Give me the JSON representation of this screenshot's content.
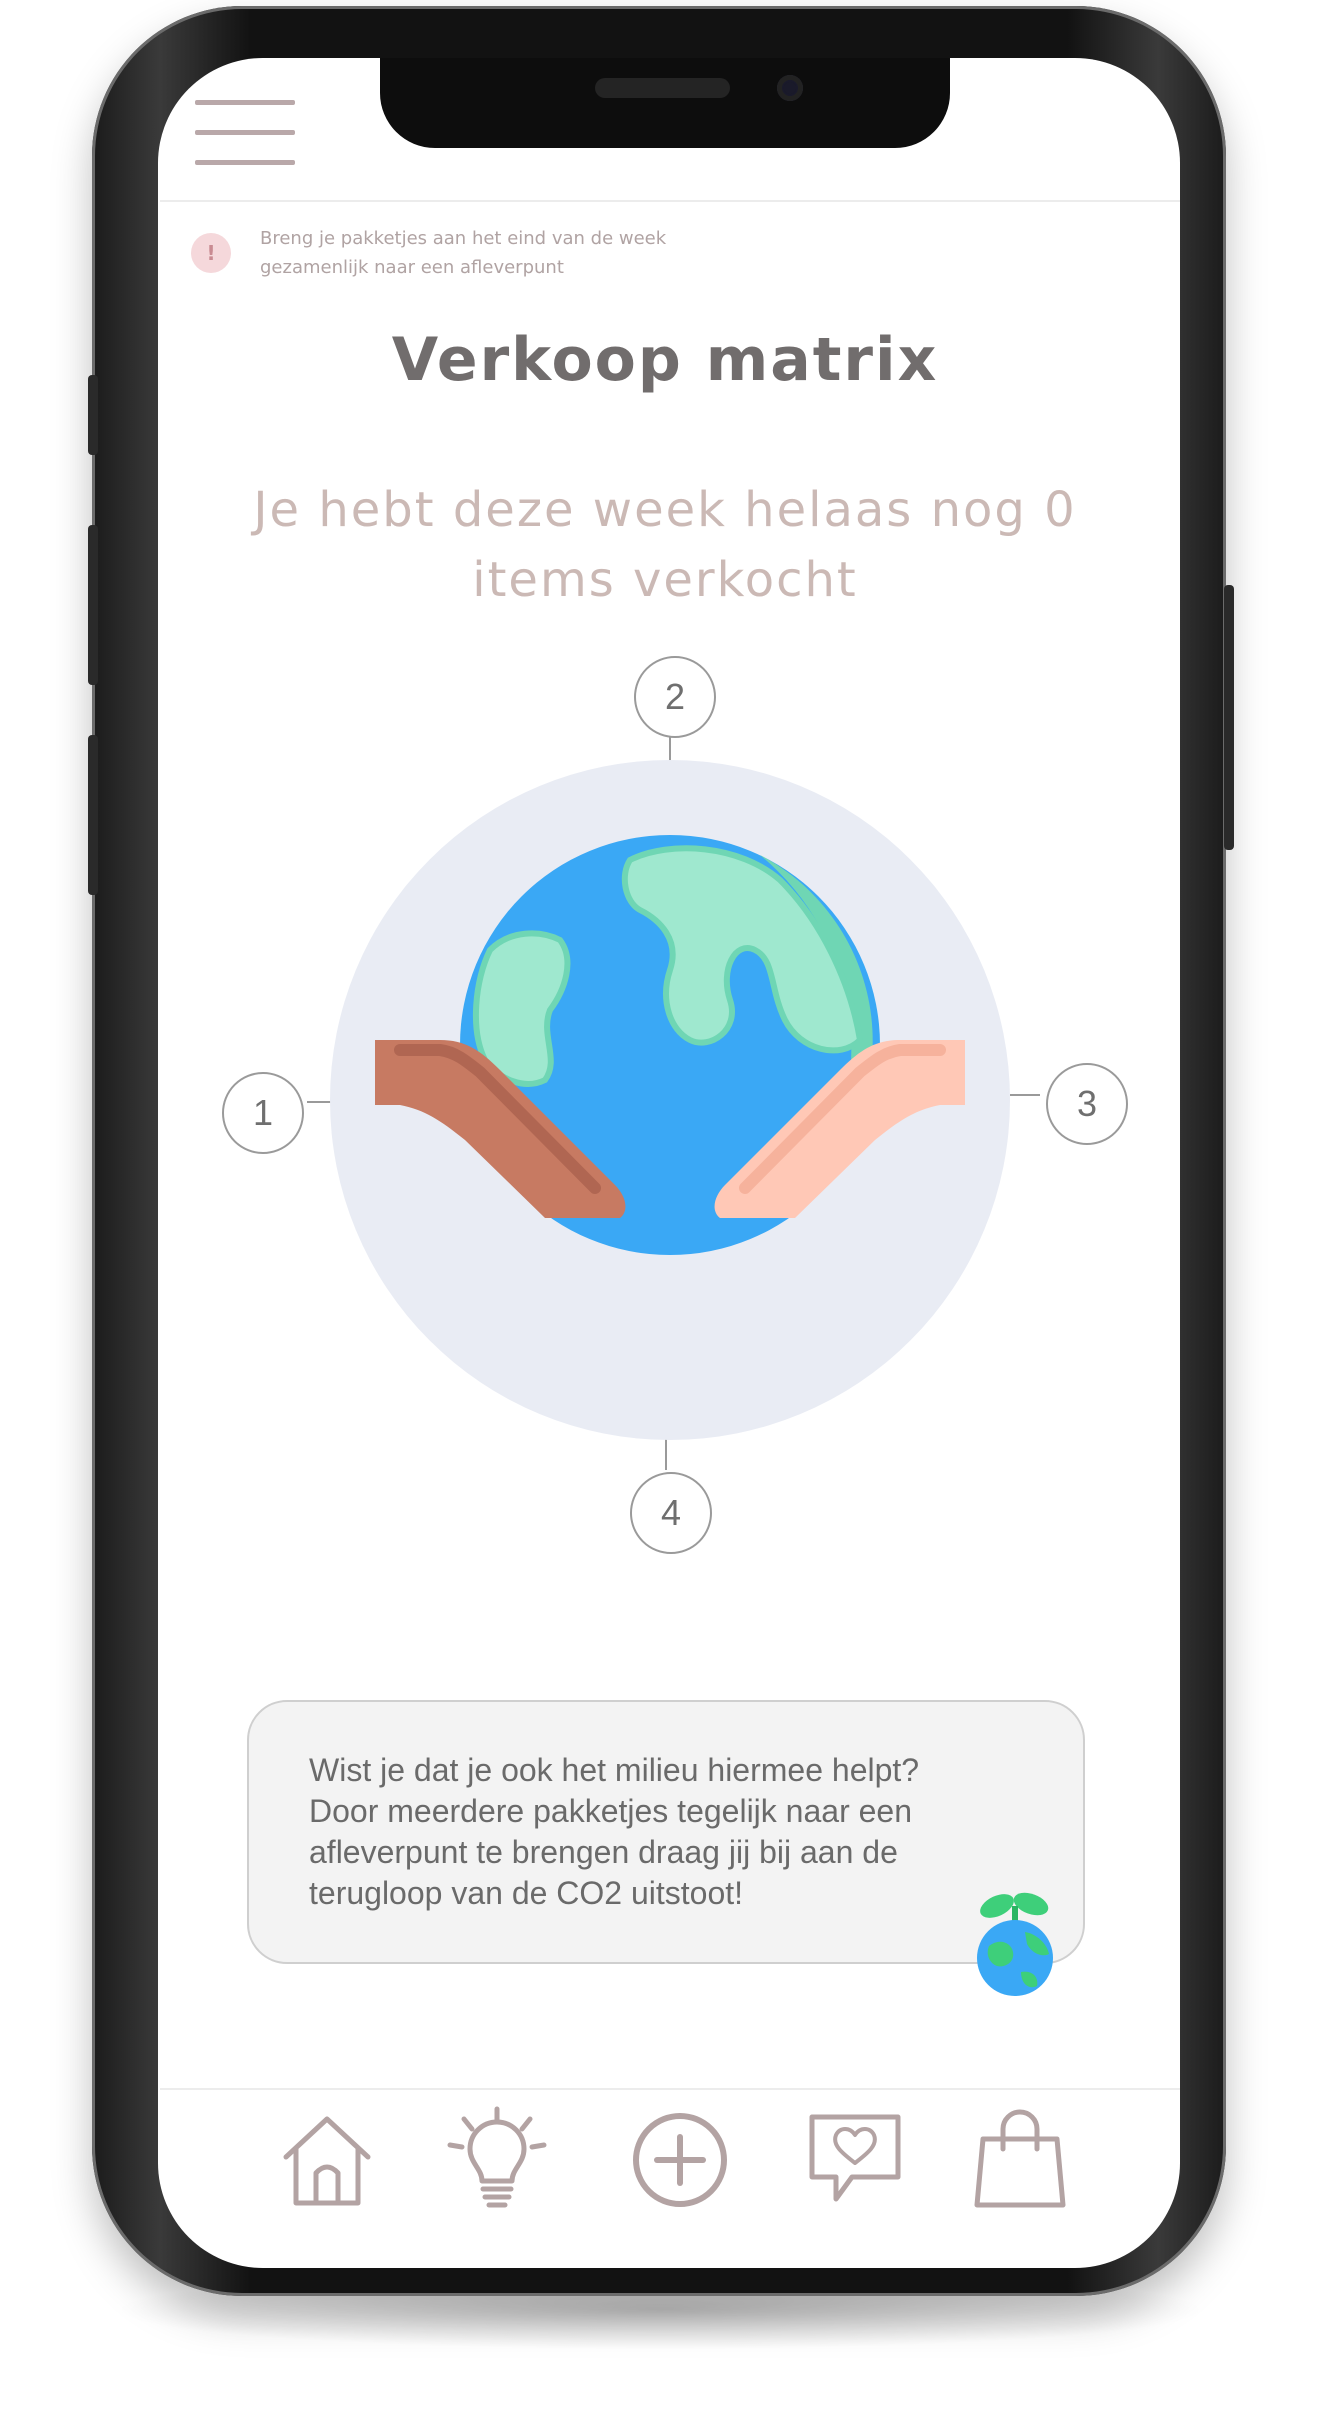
{
  "header": {
    "menu_icon": "hamburger-menu-icon",
    "alert": {
      "icon_text": "!",
      "line1": "Breng je pakketjes aan het eind van de week",
      "line2": "gezamenlijk naar een afleverpunt"
    }
  },
  "main": {
    "title": "Verkoop matrix",
    "subtitle_line1": "Je hebt deze week helaas nog 0",
    "subtitle_line2": "items verkocht",
    "illustration": "hands-holding-earth-illustration",
    "nodes": [
      "1",
      "2",
      "3",
      "4"
    ]
  },
  "tip": {
    "line1": "Wist je dat je ook het milieu hiermee helpt?",
    "line2": "Door meerdere pakketjes tegelijk naar een",
    "line3": "afleverpunt te brengen draag jij bij aan de",
    "line4": "terugloop van de CO2 uitstoot!",
    "icon": "earth-sprout-icon"
  },
  "bottom_nav": {
    "items": [
      {
        "icon": "home-icon"
      },
      {
        "icon": "lightbulb-icon"
      },
      {
        "icon": "add-circle-icon"
      },
      {
        "icon": "chat-heart-icon"
      },
      {
        "icon": "shopping-bag-icon"
      }
    ]
  },
  "colors": {
    "icon_stroke": "#b3a3a3",
    "title": "#716d6d",
    "subtitle": "#cbb9b5",
    "globe_ocean": "#3aa8f5",
    "globe_land": "#9fe8cf",
    "hand_left": "#c77a62",
    "hand_right": "#ffc8b6",
    "matrix_background": "#e9ecf4"
  }
}
